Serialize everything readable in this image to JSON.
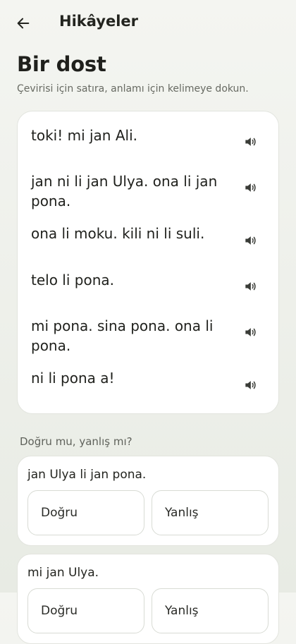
{
  "header": {
    "title": "Hikâyeler",
    "back_icon": "arrow-left-icon"
  },
  "story": {
    "title": "Bir dost",
    "subtitle": "Çevirisi için satıra, anlamı için kelimeye dokun.",
    "lines": [
      {
        "text": "toki! mi jan Ali.",
        "icon": "speaker-icon"
      },
      {
        "text": "jan ni li jan Ulya. ona li jan pona.",
        "icon": "speaker-icon"
      },
      {
        "text": "ona li moku. kili ni li suli.",
        "icon": "speaker-icon"
      },
      {
        "text": "telo li pona.",
        "icon": "speaker-icon"
      },
      {
        "text": "mi pona. sina pona. ona li pona.",
        "icon": "speaker-icon"
      },
      {
        "text": "ni li pona a!",
        "icon": "speaker-icon"
      }
    ]
  },
  "quiz": {
    "label": "Doğru mu, yanlış mı?",
    "questions": [
      {
        "text": "jan Ulya li jan pona.",
        "true_label": "Doğru",
        "false_label": "Yanlış"
      },
      {
        "text": "mi jan Ulya.",
        "true_label": "Doğru",
        "false_label": "Yanlış"
      }
    ]
  }
}
